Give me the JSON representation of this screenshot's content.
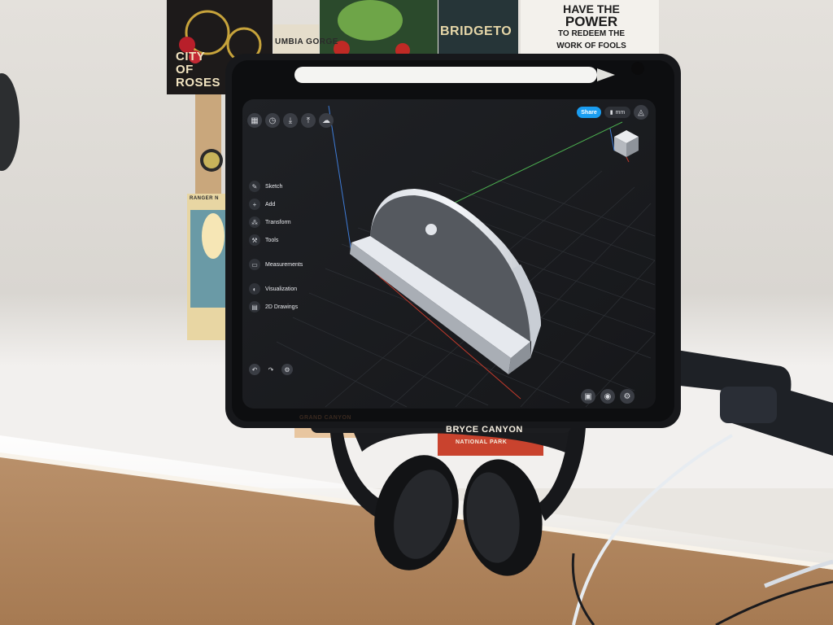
{
  "posters": {
    "city_of_roses": "CITY OF ROSES",
    "columbia_gorge": "UMBIA GORGE",
    "bridgeton": "BRIDGETO",
    "quote_lines": [
      "HAVE THE",
      "POWER",
      "TO REDEEM THE",
      "WORK OF FOOLS"
    ],
    "ranger_naturalist": "RANGER N",
    "grand_canyon": "GRAND CANYON",
    "bryce_canyon": "BRYCE CANYON",
    "bryce_sub": "NATIONAL PARK"
  },
  "app": {
    "share_label": "Share",
    "unit_label": "mm",
    "menu": [
      {
        "label": "Sketch",
        "icon": "pencil-icon"
      },
      {
        "label": "Add",
        "icon": "plus-icon"
      },
      {
        "label": "Transform",
        "icon": "transform-icon"
      },
      {
        "label": "Tools",
        "icon": "wrench-icon"
      },
      {
        "label": "Measurements",
        "icon": "ruler-icon"
      },
      {
        "label": "Visualization",
        "icon": "palette-icon"
      },
      {
        "label": "2D Drawings",
        "icon": "drawing-icon"
      }
    ],
    "toolbar_icons": [
      "grid-icon",
      "history-icon",
      "download-icon",
      "upload-icon",
      "cloud-icon"
    ],
    "bottom_left_icons": [
      "undo-icon",
      "redo-icon",
      "settings-icon"
    ],
    "bottom_right_icons": [
      "camera-icon",
      "view-icon",
      "gear-icon"
    ]
  }
}
